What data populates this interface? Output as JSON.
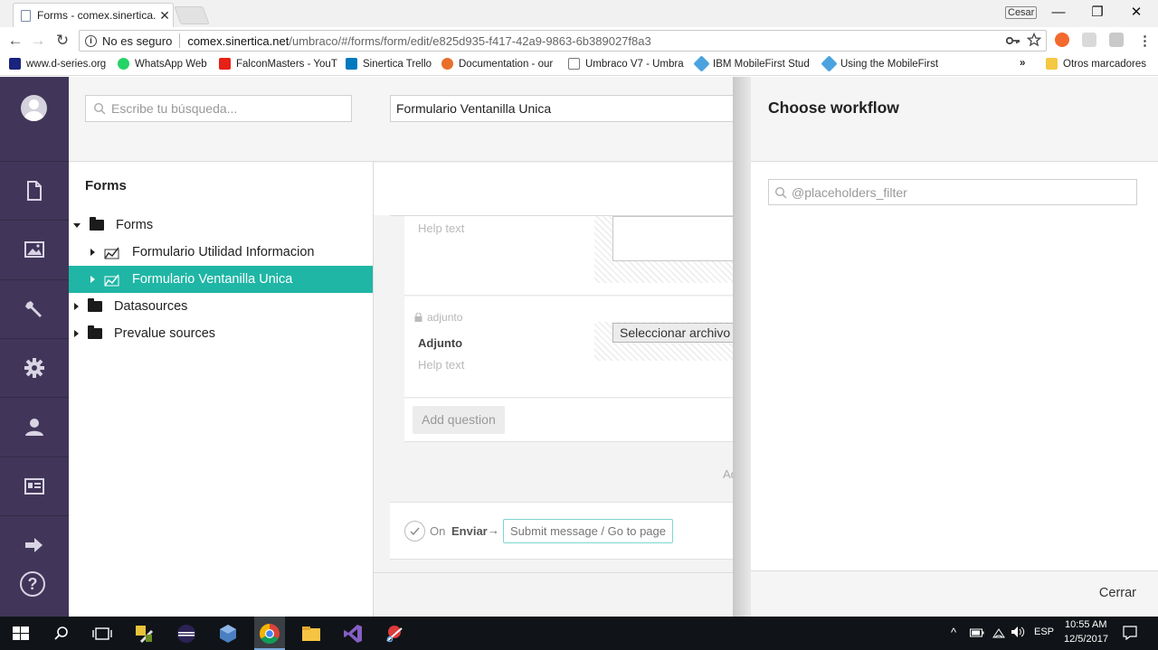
{
  "browser": {
    "tab_title": "Forms - comex.sinertica.n",
    "tab_close": "✕",
    "user_chip": "Cesar",
    "window_controls": {
      "minimize": "—",
      "restore": "❐",
      "close": "✕"
    },
    "nav": {
      "back": "←",
      "forward": "→",
      "reload": "↻"
    },
    "security_label": "No es seguro",
    "url_host": "comex.sinertica.net",
    "url_path": "/umbraco/#/forms/form/edit/e825d935-f417-42a9-9863-6b389027f8a3",
    "bookmarks": [
      {
        "label": "www.d-series.org",
        "icon": "d-series-icon",
        "color": "#1a237e"
      },
      {
        "label": "WhatsApp Web",
        "icon": "whatsapp-icon",
        "color": "#25d366"
      },
      {
        "label": "FalconMasters - YouT",
        "icon": "youtube-icon",
        "color": "#e62117"
      },
      {
        "label": "Sinertica Trello",
        "icon": "trello-icon",
        "color": "#0079bf"
      },
      {
        "label": "Documentation - our",
        "icon": "umbraco-icon",
        "color": "#e8702a"
      },
      {
        "label": "Umbraco V7 - Umbra",
        "icon": "page-icon",
        "color": "#ffffff"
      },
      {
        "label": "IBM MobileFirst Stud",
        "icon": "mobilefirst-icon",
        "color": "#4aa3df"
      },
      {
        "label": "Using the MobileFirst",
        "icon": "mobilefirst-icon",
        "color": "#4aa3df"
      }
    ],
    "bookmarks_overflow": "»",
    "other_bookmarks": "Otros marcadores"
  },
  "sections": [
    {
      "name": "content",
      "icon": "document-icon"
    },
    {
      "name": "media",
      "icon": "image-icon"
    },
    {
      "name": "settings",
      "icon": "wrench-icon"
    },
    {
      "name": "developer",
      "icon": "gear-icon"
    },
    {
      "name": "users",
      "icon": "user-icon"
    },
    {
      "name": "members",
      "icon": "id-card-icon"
    },
    {
      "name": "forms",
      "icon": "arrow-right-icon"
    },
    {
      "name": "help",
      "icon": "help-icon"
    }
  ],
  "tree": {
    "search_placeholder": "Escribe tu búsqueda...",
    "title": "Forms",
    "items": [
      {
        "label": "Forms",
        "type": "folder",
        "expanded": true
      },
      {
        "label": "Formulario Utilidad Informacion",
        "type": "form"
      },
      {
        "label": "Formulario Ventanilla Unica",
        "type": "form",
        "selected": true
      },
      {
        "label": "Datasources",
        "type": "folder"
      },
      {
        "label": "Prevalue sources",
        "type": "folder"
      }
    ]
  },
  "editor": {
    "form_name": "Formulario Ventanilla Unica",
    "field1_help": "Help text",
    "field2_alias": "adjunto",
    "field2_label": "Adjunto",
    "field2_help": "Help text",
    "file_button": "Seleccionar archivo",
    "add_question": "Add question",
    "add_page_partial": "Ac",
    "submit_on": "On",
    "submit_button_name": "Enviar",
    "submit_arrow": "→",
    "submit_action": "Submit message / Go to page"
  },
  "dialog": {
    "title": "Choose workflow",
    "filter_placeholder": "@placeholders_filter",
    "close_button": "Cerrar"
  },
  "taskbar": {
    "language": "ESP",
    "time": "10:55 AM",
    "date": "12/5/2017"
  },
  "colors": {
    "sections_bg": "#413659",
    "selected_tree": "#1fb6a5",
    "submit_border": "#7ed6cc"
  }
}
